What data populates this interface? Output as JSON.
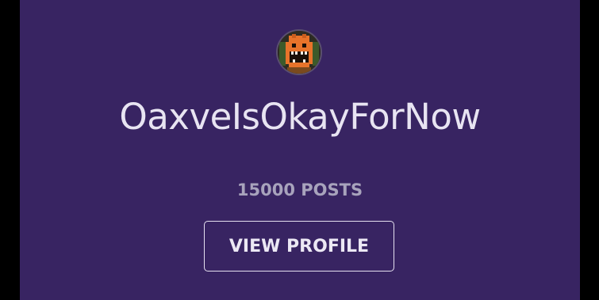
{
  "profile": {
    "avatar_icon": "monster-avatar-icon",
    "username": "OaxveIsOkayForNow",
    "post_count": "15000 POSTS",
    "view_profile_label": "VIEW PROFILE"
  },
  "colors": {
    "card_background": "#382462",
    "outer_background": "#000000",
    "text_primary": "#e8e4f2",
    "text_muted": "#a8a3bc",
    "avatar_orange": "#e8732a"
  }
}
